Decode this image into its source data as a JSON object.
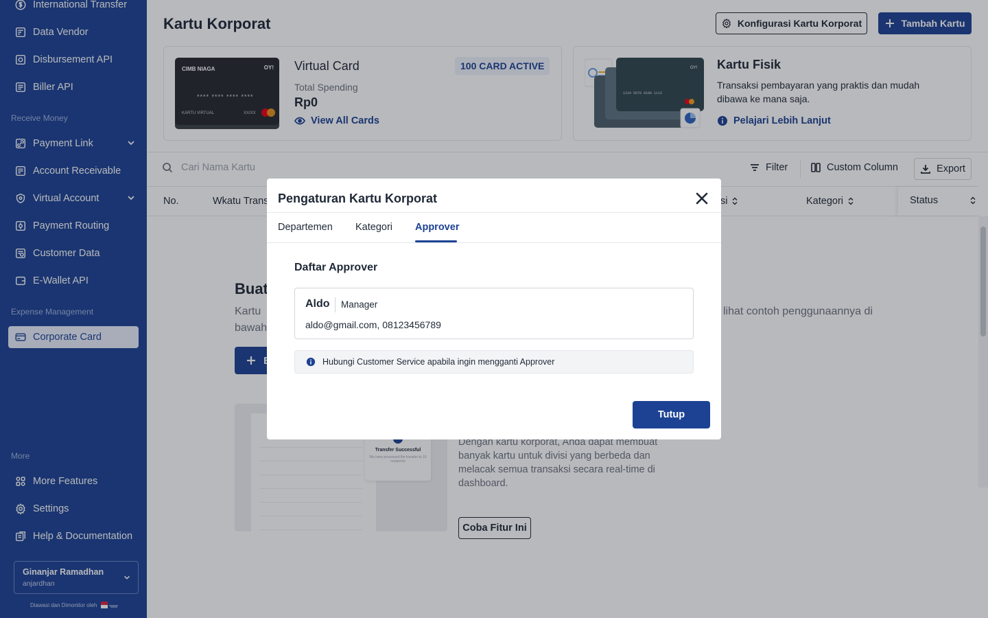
{
  "sidebar": {
    "items_top": [
      {
        "label": "International Transfer",
        "icon": "dollar-circle-icon"
      },
      {
        "label": "Data Vendor",
        "icon": "vendor-icon"
      },
      {
        "label": "Disbursement API",
        "icon": "api-icon"
      },
      {
        "label": "Biller API",
        "icon": "biller-icon"
      }
    ],
    "section_receive": "Receive Money",
    "items_receive": [
      {
        "label": "Payment Link",
        "icon": "link-icon"
      },
      {
        "label": "Account Receivable",
        "icon": "receivable-icon"
      },
      {
        "label": "Virtual Account",
        "icon": "shield-icon"
      },
      {
        "label": "Payment Routing",
        "icon": "routing-icon"
      },
      {
        "label": "Customer Data",
        "icon": "customer-icon"
      },
      {
        "label": "E-Wallet API",
        "icon": "wallet-icon"
      }
    ],
    "section_expense": "Expense Management",
    "active_item": {
      "label": "Corporate Card",
      "icon": "card-icon"
    },
    "section_more": "More",
    "items_more": [
      {
        "label": "More Features",
        "icon": "grid-icon"
      },
      {
        "label": "Settings",
        "icon": "gear-icon"
      },
      {
        "label": "Help & Documentation",
        "icon": "help-icon"
      }
    ],
    "user": {
      "name": "Ginanjar Ramadhan",
      "handle": "anjardhan"
    },
    "supervised_text": "Diawasi dan Dimonitor oleh"
  },
  "header": {
    "title": "Kartu Korporat",
    "config_button": "Konfigurasi Kartu Korporat",
    "add_button": "Tambah Kartu"
  },
  "virtual_card": {
    "bank": "CIMB NIAGA",
    "brand": "OY!",
    "card_number": "**** **** **** ****",
    "card_label": "KARTU VIRTUAL",
    "card_expiry": "XX/XX",
    "title": "Virtual Card",
    "badge": "100 CARD ACTIVE",
    "spending_label": "Total Spending",
    "spending_value": "Rp0",
    "link": "View All Cards"
  },
  "physical_card": {
    "title": "Kartu Fisik",
    "description": "Transaksi pembayaran yang praktis dan mudah dibawa ke mana saja.",
    "link": "Pelajari Lebih Lanjut"
  },
  "toolbar": {
    "search_placeholder": "Cari Nama Kartu",
    "filter": "Filter",
    "custom_column": "Custom Column",
    "export": "Export"
  },
  "table": {
    "headers": {
      "no": "No.",
      "waktu": "Wkatu Trans",
      "divisi": "si",
      "kategori": "Kategori",
      "status": "Status"
    }
  },
  "empty_state": {
    "title": "Buat",
    "desc_left": "Kartu",
    "desc_right": "lihat contoh penggunaannya di",
    "desc_line2": "bawah",
    "button": "B",
    "feature_desc": "Dengan kartu korporat, Anda dapat membuat banyak kartu untuk divisi yang berbeda dan melacak semua transaksi secara real-time di dashboard.",
    "try_button": "Coba Fitur Ini",
    "illus_toast_title": "Transfer Successful",
    "illus_toast_sub": "We have processed the transfer to 10 recipients"
  },
  "modal": {
    "title": "Pengaturan Kartu Korporat",
    "tabs": [
      "Departemen",
      "Kategori",
      "Approver"
    ],
    "active_tab": "Approver",
    "section_title": "Daftar Approver",
    "approver": {
      "name": "Aldo",
      "role": "Manager",
      "contact": "aldo@gmail.com, 08123456789"
    },
    "info": "Hubungi Customer Service apabila ingin mengganti Approver",
    "close_button": "Tutup"
  },
  "colors": {
    "primary": "#1d4294",
    "sidebar": "#1d4294",
    "overlay": "rgba(20,24,32,0.30)"
  }
}
